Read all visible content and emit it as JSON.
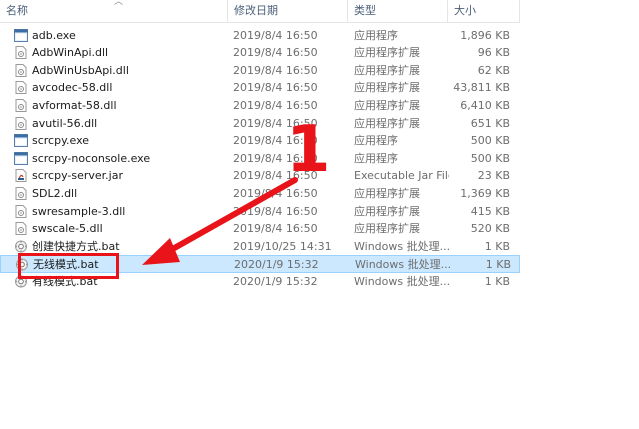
{
  "columns": {
    "name": "名称",
    "modified": "修改日期",
    "type": "类型",
    "size": "大小"
  },
  "files": [
    {
      "name": "adb.exe",
      "modified": "2019/8/4 16:50",
      "type": "应用程序",
      "size": "1,896 KB",
      "icon": "exe-icon"
    },
    {
      "name": "AdbWinApi.dll",
      "modified": "2019/8/4 16:50",
      "type": "应用程序扩展",
      "size": "96 KB",
      "icon": "dll-icon"
    },
    {
      "name": "AdbWinUsbApi.dll",
      "modified": "2019/8/4 16:50",
      "type": "应用程序扩展",
      "size": "62 KB",
      "icon": "dll-icon"
    },
    {
      "name": "avcodec-58.dll",
      "modified": "2019/8/4 16:50",
      "type": "应用程序扩展",
      "size": "43,811 KB",
      "icon": "dll-icon"
    },
    {
      "name": "avformat-58.dll",
      "modified": "2019/8/4 16:50",
      "type": "应用程序扩展",
      "size": "6,410 KB",
      "icon": "dll-icon"
    },
    {
      "name": "avutil-56.dll",
      "modified": "2019/8/4 16:50",
      "type": "应用程序扩展",
      "size": "651 KB",
      "icon": "dll-icon"
    },
    {
      "name": "scrcpy.exe",
      "modified": "2019/8/4 16:50",
      "type": "应用程序",
      "size": "500 KB",
      "icon": "exe-icon"
    },
    {
      "name": "scrcpy-noconsole.exe",
      "modified": "2019/8/4 16:50",
      "type": "应用程序",
      "size": "500 KB",
      "icon": "exe-icon"
    },
    {
      "name": "scrcpy-server.jar",
      "modified": "2019/8/4 16:50",
      "type": "Executable Jar File",
      "size": "23 KB",
      "icon": "jar-icon"
    },
    {
      "name": "SDL2.dll",
      "modified": "2019/8/4 16:50",
      "type": "应用程序扩展",
      "size": "1,369 KB",
      "icon": "dll-icon"
    },
    {
      "name": "swresample-3.dll",
      "modified": "2019/8/4 16:50",
      "type": "应用程序扩展",
      "size": "415 KB",
      "icon": "dll-icon"
    },
    {
      "name": "swscale-5.dll",
      "modified": "2019/8/4 16:50",
      "type": "应用程序扩展",
      "size": "520 KB",
      "icon": "dll-icon"
    },
    {
      "name": "创建快捷方式.bat",
      "modified": "2019/10/25 14:31",
      "type": "Windows 批处理...",
      "size": "1 KB",
      "icon": "bat-icon"
    },
    {
      "name": "无线模式.bat",
      "modified": "2020/1/9 15:32",
      "type": "Windows 批处理...",
      "size": "1 KB",
      "icon": "bat-icon",
      "selected": true
    },
    {
      "name": "有线模式.bat",
      "modified": "2020/1/9 15:32",
      "type": "Windows 批处理...",
      "size": "1 KB",
      "icon": "bat-icon"
    }
  ],
  "annotation": {
    "number": "1",
    "color": "#e8141a"
  },
  "colors": {
    "selection_bg": "#cce8ff",
    "selection_border": "#99d1ff",
    "header_text": "#4c607a"
  }
}
